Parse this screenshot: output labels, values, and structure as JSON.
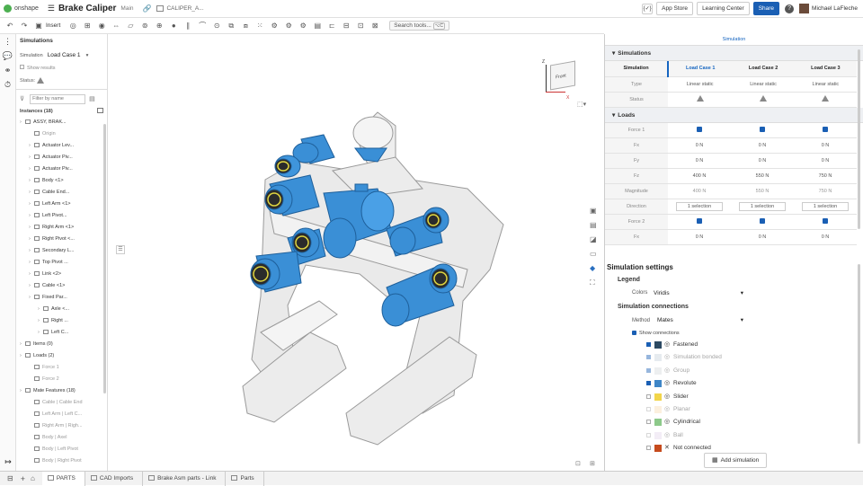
{
  "header": {
    "logo_text": "onshape",
    "doc_title": "Brake Caliper",
    "branch": "Main",
    "tab_name": "CALIPER_A...",
    "app_store": "App Store",
    "learning_center": "Learning Center",
    "share": "Share",
    "help": "?",
    "user": "Michael LaFleche"
  },
  "toolbar": {
    "insert": "Insert",
    "search_placeholder": "Search tools...",
    "search_shortcut": "⌥C"
  },
  "left_panel": {
    "title": "Simulations",
    "sim_label": "Simulation",
    "sim_value": "Load Case 1",
    "show_results": "Show results",
    "status_label": "Status:",
    "filter_placeholder": "Filter by name",
    "instances_header": "Instances (18)",
    "tree": [
      {
        "label": "ASSY, BRAK...",
        "indent": 0
      },
      {
        "label": "Origin",
        "indent": 1,
        "muted": true
      },
      {
        "label": "Actuator Lev...",
        "indent": 1
      },
      {
        "label": "Actuator Piv...",
        "indent": 1
      },
      {
        "label": "Actuator Piv...",
        "indent": 1
      },
      {
        "label": "Body <1>",
        "indent": 1
      },
      {
        "label": "Cable End...",
        "indent": 1
      },
      {
        "label": "Left Arm <1>",
        "indent": 1
      },
      {
        "label": "Left Pivot...",
        "indent": 1
      },
      {
        "label": "Right Arm <1>",
        "indent": 1
      },
      {
        "label": "Right Pivot <...",
        "indent": 1
      },
      {
        "label": "Secondary L...",
        "indent": 1
      },
      {
        "label": "Top Pivot ...",
        "indent": 1
      },
      {
        "label": "Link <2>",
        "indent": 1
      },
      {
        "label": "Cable <1>",
        "indent": 1
      },
      {
        "label": "Fixed Par...",
        "indent": 1
      },
      {
        "label": "Axle <...",
        "indent": 2
      },
      {
        "label": "Right ...",
        "indent": 2
      },
      {
        "label": "Left C...",
        "indent": 2
      },
      {
        "label": "Items (0)",
        "indent": 0
      },
      {
        "label": "Loads (2)",
        "indent": 0
      },
      {
        "label": "Force 1",
        "indent": 1,
        "muted": true
      },
      {
        "label": "Force 2",
        "indent": 1,
        "muted": true
      },
      {
        "label": "Mate Features (18)",
        "indent": 0
      },
      {
        "label": "Cable | Cable End",
        "indent": 1,
        "muted": true
      },
      {
        "label": "Left Arm | Left C...",
        "indent": 1,
        "muted": true
      },
      {
        "label": "Right Arm | Righ...",
        "indent": 1,
        "muted": true
      },
      {
        "label": "Body | Axel",
        "indent": 1,
        "muted": true
      },
      {
        "label": "Body | Left Pivot",
        "indent": 1,
        "muted": true
      },
      {
        "label": "Body | Right Pivot",
        "indent": 1,
        "muted": true
      }
    ]
  },
  "viewcube": {
    "front": "Front",
    "z": "Z",
    "x": "X"
  },
  "right_panel": {
    "tab": "Simulation",
    "simulations_section": "Simulations",
    "table": {
      "header": [
        "Simulation",
        "Load Case 1",
        "Load Case 2",
        "Load Case 3"
      ],
      "type_label": "Type",
      "types": [
        "Linear static",
        "Linear static",
        "Linear static"
      ],
      "status_label": "Status"
    },
    "loads_section": "Loads",
    "loads": [
      {
        "label": "Force 1",
        "kind": "check"
      },
      {
        "label": "Fx",
        "values": [
          "0 N",
          "0 N",
          "0 N"
        ]
      },
      {
        "label": "Fy",
        "values": [
          "0 N",
          "0 N",
          "0 N"
        ]
      },
      {
        "label": "Fz",
        "values": [
          "400 N",
          "550 N",
          "750 N"
        ]
      },
      {
        "label": "Magnitude",
        "values": [
          "400 N",
          "550 N",
          "750 N"
        ]
      },
      {
        "label": "Direction",
        "values": [
          "1 selection",
          "1 selection",
          "1 selection"
        ]
      },
      {
        "label": "Force 2",
        "kind": "check"
      },
      {
        "label": "Fx",
        "values": [
          "0 N",
          "0 N",
          "0 N"
        ]
      }
    ],
    "settings_title": "Simulation settings",
    "legend_title": "Legend",
    "colors_label": "Colors",
    "colors_value": "Viridis",
    "connections_title": "Simulation connections",
    "method_label": "Method",
    "method_value": "Mates",
    "show_connections": "Show connections",
    "connections": [
      {
        "label": "Fastened",
        "color": "#2d4a63",
        "checked": true
      },
      {
        "label": "Simulation bonded",
        "color": "#c9d3dd",
        "checked": true,
        "muted": true
      },
      {
        "label": "Group",
        "color": "#d9dce0",
        "checked": true,
        "muted": true
      },
      {
        "label": "Revolute",
        "color": "#3f86c7",
        "checked": true
      },
      {
        "label": "Slider",
        "color": "#f2d54a",
        "checked": false
      },
      {
        "label": "Planar",
        "color": "#f9dfb8",
        "checked": false,
        "muted": true
      },
      {
        "label": "Cylindrical",
        "color": "#8dc98a",
        "checked": false
      },
      {
        "label": "Ball",
        "color": "#e6d9ec",
        "checked": false,
        "muted": true
      },
      {
        "label": "Not connected",
        "color": "#c64b1d",
        "checked": false
      }
    ],
    "add_simulation": "Add simulation"
  },
  "bottom_tabs": [
    "PARTS",
    "CAD Imports",
    "Brake Asm parts - Link",
    "Parts"
  ],
  "colors": {
    "accent": "#1565c0",
    "share": "#1a5fb4",
    "part_blue": "#3a8fd6",
    "part_gray": "#e4e4e4"
  }
}
